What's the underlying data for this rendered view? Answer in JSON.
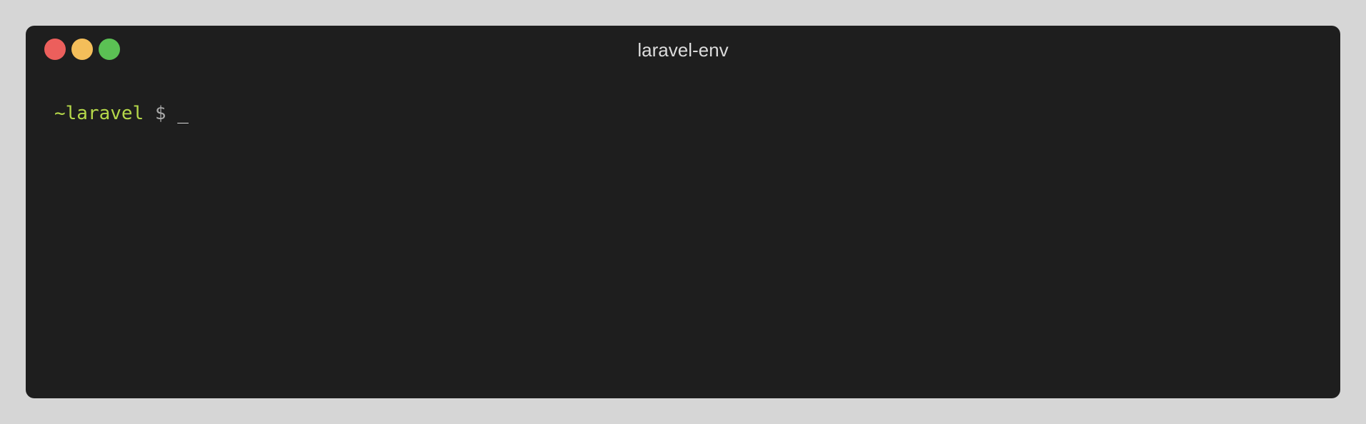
{
  "window": {
    "title": "laravel-env",
    "controls": {
      "close_color": "#ec5f5c",
      "minimize_color": "#f4be5a",
      "zoom_color": "#5bc154"
    }
  },
  "terminal": {
    "prompt_path": "~laravel",
    "prompt_symbol": "$",
    "cursor": "_",
    "colors": {
      "background": "#1e1e1e",
      "prompt_path": "#b5d84a",
      "prompt_symbol": "#a8a8a8"
    }
  }
}
